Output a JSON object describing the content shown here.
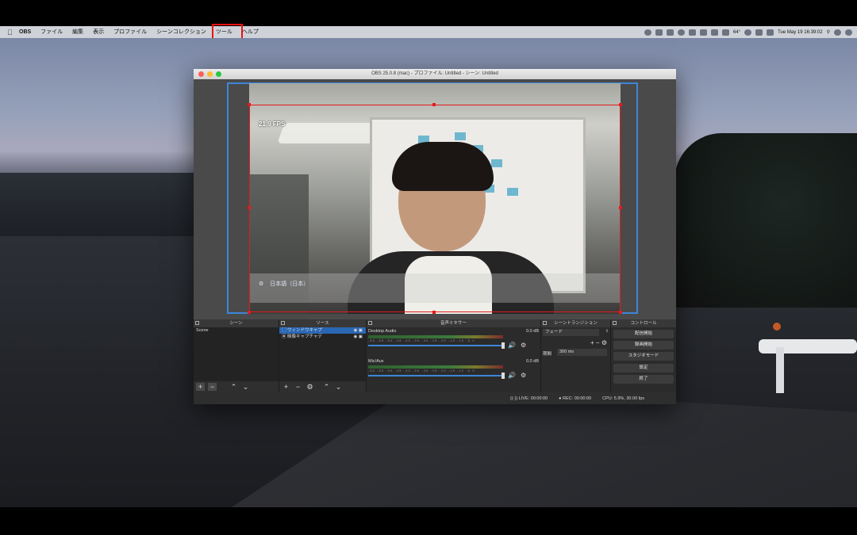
{
  "menubar": {
    "app": "OBS",
    "items": [
      "ファイル",
      "編集",
      "表示",
      "プロファイル",
      "シーンコレクション",
      "ツール",
      "ヘルプ"
    ],
    "highlighted_item": "ツール",
    "temperature": "64°",
    "clock": "Tue May 19  16:39:02"
  },
  "obs": {
    "window_title": "OBS 25.0.8 (mac) - プロファイル: Untitled - シーン: Untitled",
    "preview": {
      "fps_text": "21.9 FPS",
      "ime_text": "日本語（日本）"
    },
    "docks": {
      "scenes": {
        "title": "シーン",
        "items": [
          "Scene"
        ]
      },
      "sources": {
        "title": "ソース",
        "items": [
          {
            "label": "ウィンドウキャプ",
            "selected": true
          },
          {
            "label": "映像キャプチャデ",
            "selected": false
          }
        ]
      },
      "mixer": {
        "title": "音声ミキサー",
        "tracks": [
          {
            "name": "Desktop Audio",
            "db": "0.0 dB"
          },
          {
            "name": "Mic/Aux",
            "db": "0.0 dB"
          }
        ],
        "ticks": "-60 -55 -50 -45 -40 -35 -30 -25 -20 -15 -10 -5 0"
      },
      "transitions": {
        "title": "シーントランジション",
        "selected": "フェード",
        "duration_label": "期間",
        "duration_value": "300 ms"
      },
      "controls": {
        "title": "コントロール",
        "buttons": [
          "配信開始",
          "録画開始",
          "スタジオモード",
          "設定",
          "終了"
        ]
      }
    },
    "status": {
      "live": "LIVE: 00:00:00",
      "rec": "REC: 00:00:00",
      "cpu": "CPU: 5.9%, 30.00 fps"
    }
  },
  "colors": {
    "highlight_red": "#e11111",
    "selection_blue": "#2a67b3",
    "canvas_border": "#3d86d8"
  }
}
